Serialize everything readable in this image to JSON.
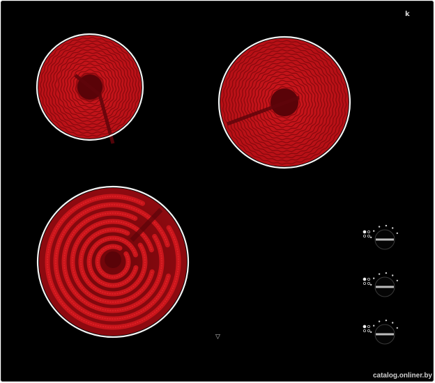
{
  "colors": {
    "glass": "#000000",
    "coil_glow": "#c8151b",
    "coil_dark": "#7a070b",
    "coil_core": "#5a0308",
    "ring": "#f4f4f4",
    "marking": "#d0d0d0"
  },
  "cooktop": {
    "brand_mark": "k",
    "center_mark": "▽",
    "zones": [
      {
        "name": "rear-left-zone",
        "pattern": "concentric-wave"
      },
      {
        "name": "rear-right-zone",
        "pattern": "concentric-wave"
      },
      {
        "name": "front-left-zone",
        "pattern": "serpentine"
      }
    ],
    "knobs": [
      {
        "name": "knob-rear-left-zone"
      },
      {
        "name": "knob-rear-right-zone"
      },
      {
        "name": "knob-front-left-zone"
      }
    ]
  },
  "watermark": "catalog.onliner.by"
}
